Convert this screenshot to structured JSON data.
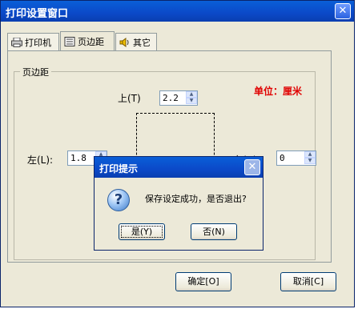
{
  "window": {
    "title": "打印设置窗口",
    "close_glyph": "✕"
  },
  "tabs": [
    {
      "label": "打印机",
      "icon": "printer-icon"
    },
    {
      "label": "页边距",
      "icon": "page-icon",
      "active": true
    },
    {
      "label": "其它",
      "icon": "speaker-icon"
    }
  ],
  "margins": {
    "group_title": "页边距",
    "unit_label": "单位：厘米",
    "top": {
      "label": "上(T)",
      "value": "2.2"
    },
    "left": {
      "label": "左(L):",
      "value": "1.8"
    },
    "right": {
      "label": "右(R):",
      "value": "0"
    }
  },
  "buttons": {
    "ok": "确定[O]",
    "cancel": "取消[C]"
  },
  "dialog": {
    "title": "打印提示",
    "message": "保存设定成功，是否退出?",
    "yes": "是(Y)",
    "no": "否(N)",
    "icon": "question-icon",
    "icon_glyph": "?",
    "close_glyph": "✕"
  },
  "colors": {
    "title_bar": "#0b49c8",
    "unit_text": "#e00000",
    "dialog_bg": "#ece9d8"
  }
}
